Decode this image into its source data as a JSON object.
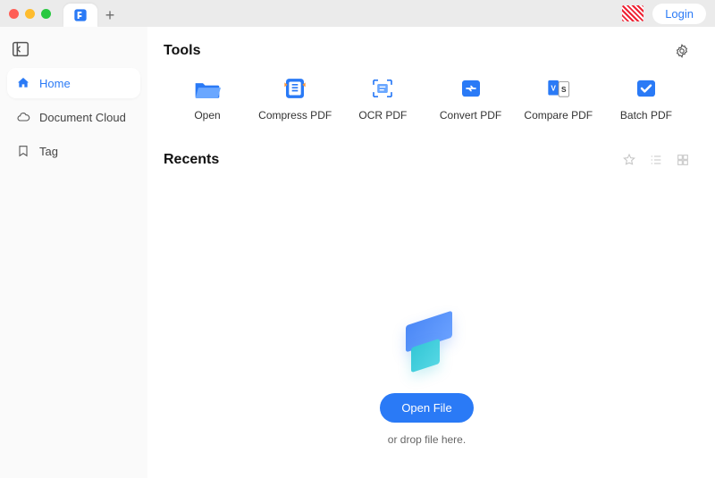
{
  "titlebar": {
    "login_label": "Login"
  },
  "sidebar": {
    "items": [
      {
        "label": "Home"
      },
      {
        "label": "Document Cloud"
      },
      {
        "label": "Tag"
      }
    ]
  },
  "tools": {
    "title": "Tools",
    "items": [
      {
        "label": "Open"
      },
      {
        "label": "Compress PDF"
      },
      {
        "label": "OCR PDF"
      },
      {
        "label": "Convert PDF"
      },
      {
        "label": "Compare PDF"
      },
      {
        "label": "Batch PDF"
      }
    ]
  },
  "recents": {
    "title": "Recents",
    "open_button": "Open File",
    "drop_hint": "or drop file here."
  }
}
